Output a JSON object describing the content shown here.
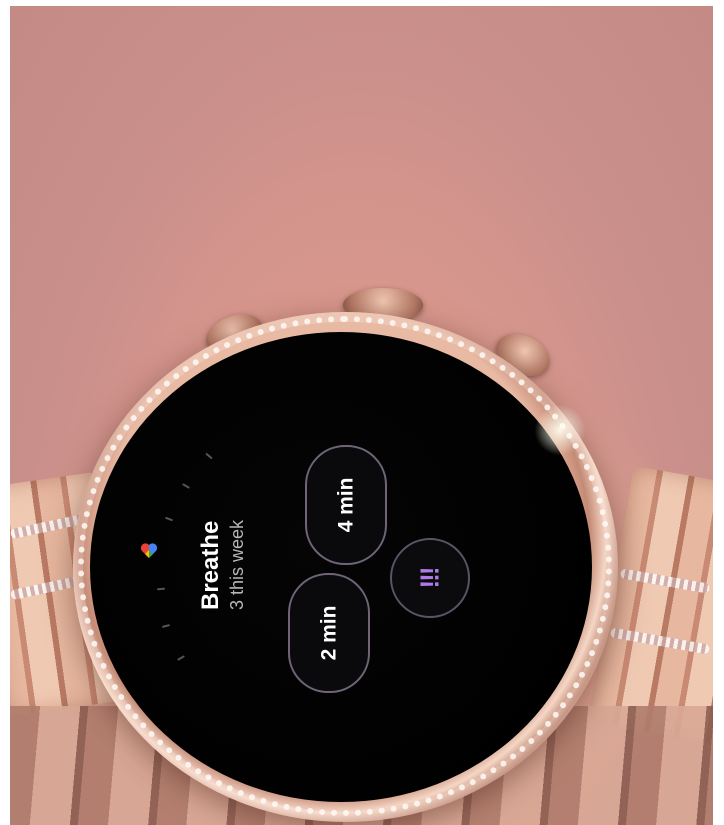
{
  "watch_app": {
    "title": "Breathe",
    "subtitle": "3 this week",
    "options": [
      {
        "label": "4 min"
      },
      {
        "label": "2 min"
      }
    ],
    "more_icon": "!!!",
    "app_icon": "fit-heart-icon"
  },
  "colors": {
    "background": "#d8978d",
    "screen": "#000000",
    "pill_border": "#6f6478",
    "accent_purple": "#b07be8",
    "subtitle_gray": "#b7b7b7"
  }
}
